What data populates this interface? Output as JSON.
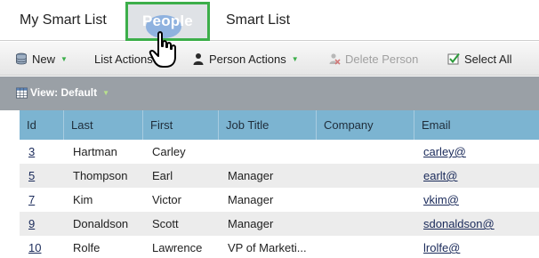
{
  "tabs": {
    "my_smart_list": "My Smart List",
    "people": "People",
    "smart_list": "Smart List"
  },
  "toolbar": {
    "new_label": "New",
    "list_actions_label": "List Actions",
    "person_actions_label": "Person Actions",
    "delete_person_label": "Delete Person",
    "select_all_label": "Select All"
  },
  "view": {
    "label": "View: Default"
  },
  "table": {
    "columns": [
      "Id",
      "Last",
      "First",
      "Job Title",
      "Company",
      "Email"
    ],
    "rows": [
      {
        "id": "3",
        "last": "Hartman",
        "first": "Carley",
        "job_title": "",
        "company": "",
        "email": "carley@"
      },
      {
        "id": "5",
        "last": "Thompson",
        "first": "Earl",
        "job_title": "Manager",
        "company": "",
        "email": "earlt@"
      },
      {
        "id": "7",
        "last": "Kim",
        "first": "Victor",
        "job_title": "Manager",
        "company": "",
        "email": "vkim@"
      },
      {
        "id": "9",
        "last": "Donaldson",
        "first": "Scott",
        "job_title": "Manager",
        "company": "",
        "email": "sdonaldson@"
      },
      {
        "id": "10",
        "last": "Rolfe",
        "first": "Lawrence",
        "job_title": "VP of Marketi...",
        "company": "",
        "email": "lrolfe@"
      }
    ]
  },
  "colors": {
    "highlight_border": "#3cae4a",
    "header_bg": "#7cb4d1",
    "view_bar_bg": "#9aa0a6"
  }
}
